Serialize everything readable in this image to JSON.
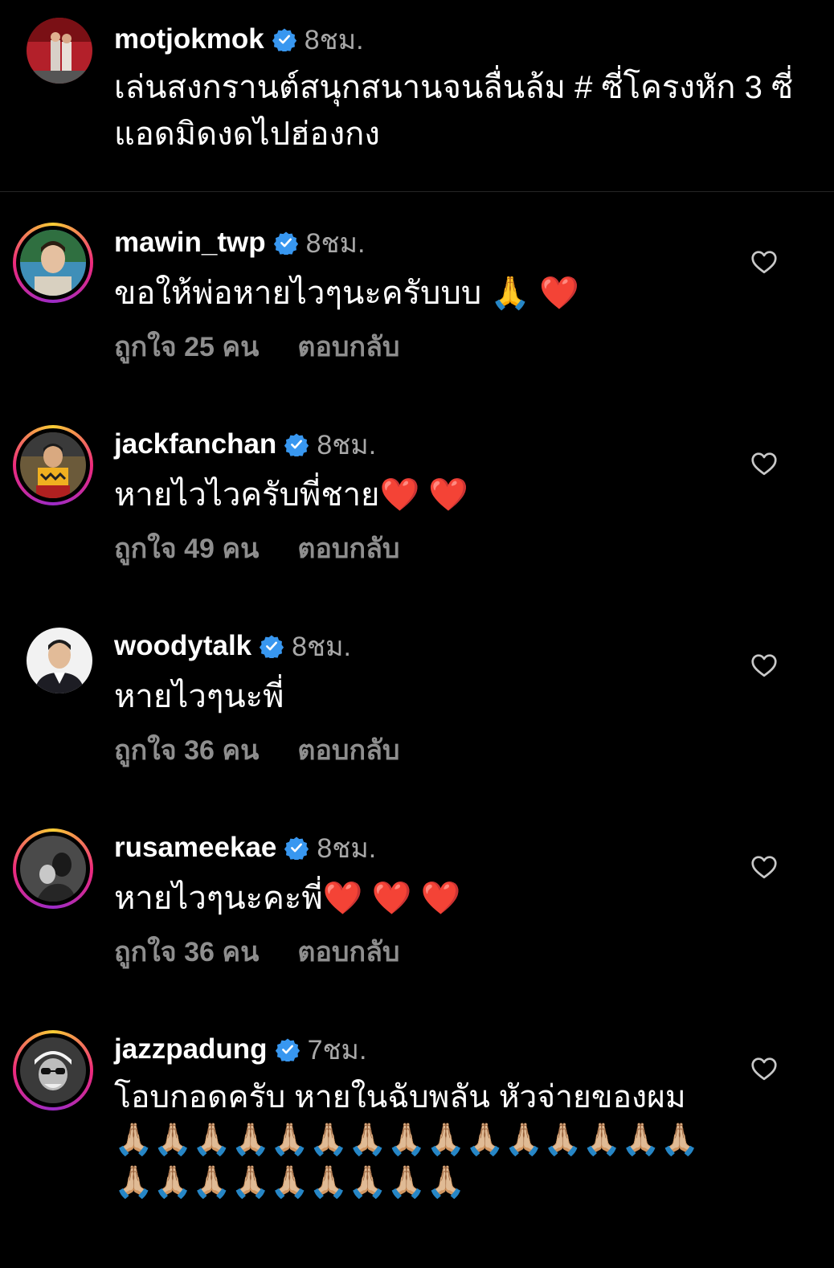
{
  "post": {
    "username": "motjokmok",
    "time": "8ชม.",
    "caption": "เล่นสงกรานต์สนุกสนานจนลื่นล้ม # ซี่โครงหัก 3 ซี่ แอดมิดงดไปฮ่องกง"
  },
  "comments": [
    {
      "username": "mawin_twp",
      "time": "8ชม.",
      "text": "ขอให้พ่อหายไวๆนะครับบบ 🙏 ❤️",
      "likes": "ถูกใจ 25 คน",
      "reply": "ตอบกลับ"
    },
    {
      "username": "jackfanchan",
      "time": "8ชม.",
      "text": "หายไวไวครับพี่ชาย❤️ ❤️",
      "likes": "ถูกใจ 49 คน",
      "reply": "ตอบกลับ"
    },
    {
      "username": "woodytalk",
      "time": "8ชม.",
      "text": "หายไวๆนะพี่",
      "likes": "ถูกใจ 36 คน",
      "reply": "ตอบกลับ"
    },
    {
      "username": "rusameekae",
      "time": "8ชม.",
      "text": "หายไวๆนะคะพี่❤️ ❤️ ❤️",
      "likes": "ถูกใจ 36 คน",
      "reply": "ตอบกลับ"
    },
    {
      "username": "jazzpadung",
      "time": "7ชม.",
      "text": "โอบกอดครับ หายในฉับพลัน  หัวจ่ายของผม 🙏🏼🙏🏼🙏🏼🙏🏼🙏🏼🙏🏼🙏🏼🙏🏼🙏🏼🙏🏼🙏🏼🙏🏼🙏🏼🙏🏼🙏🏼🙏🏼🙏🏼🙏🏼🙏🏼🙏🏼🙏🏼🙏🏼🙏🏼🙏🏼"
    }
  ],
  "icons": {
    "verified": "verified-badge-icon",
    "like": "heart-outline-icon"
  },
  "colors": {
    "background": "#000000",
    "verified": "#3897f0",
    "secondary_text": "#a8a8a8"
  }
}
